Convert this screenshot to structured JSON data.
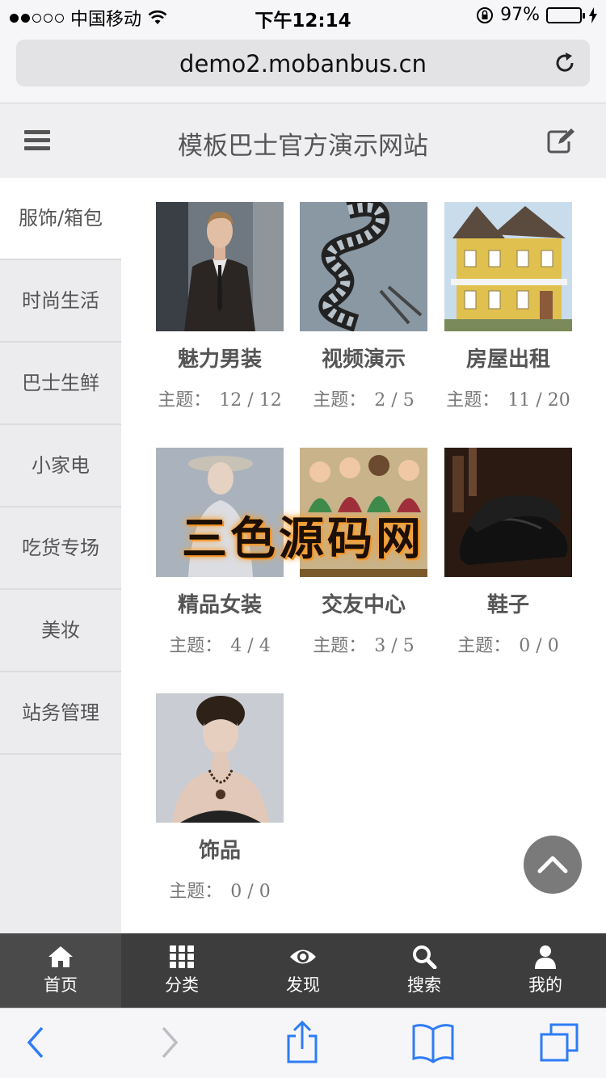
{
  "status_bar": {
    "carrier": "中国移动",
    "time": "下午12:14",
    "battery": "97%",
    "battery_level": 0.97
  },
  "browser": {
    "url": "demo2.mobanbus.cn"
  },
  "header": {
    "title": "模板巴士官方演示网站"
  },
  "sidebar": {
    "items": [
      {
        "label": "服饰/箱包"
      },
      {
        "label": "时尚生活"
      },
      {
        "label": "巴士生鲜"
      },
      {
        "label": "小家电"
      },
      {
        "label": "吃货专场"
      },
      {
        "label": "美妆"
      },
      {
        "label": "站务管理"
      }
    ]
  },
  "cards": [
    {
      "name": "魅力男装",
      "meta_label": "主题：",
      "count": "12 / 12"
    },
    {
      "name": "视频演示",
      "meta_label": "主题：",
      "count": "2 / 5"
    },
    {
      "name": "房屋出租",
      "meta_label": "主题：",
      "count": "11 / 20"
    },
    {
      "name": "精品女装",
      "meta_label": "主题：",
      "count": "4 / 4"
    },
    {
      "name": "交友中心",
      "meta_label": "主题：",
      "count": "3 / 5"
    },
    {
      "name": "鞋子",
      "meta_label": "主题：",
      "count": "0 / 0"
    },
    {
      "name": "饰品",
      "meta_label": "主题：",
      "count": "0 / 0"
    }
  ],
  "watermark": "三色源码网",
  "app_nav": {
    "items": [
      {
        "label": "首页",
        "icon": "home-icon"
      },
      {
        "label": "分类",
        "icon": "grid-icon"
      },
      {
        "label": "发现",
        "icon": "eye-icon"
      },
      {
        "label": "搜索",
        "icon": "search-icon"
      },
      {
        "label": "我的",
        "icon": "user-icon"
      }
    ]
  },
  "colors": {
    "nav_background": "#3d3d3d",
    "battery_green": "#4cd964",
    "ios_blue": "#2e7cf6"
  }
}
